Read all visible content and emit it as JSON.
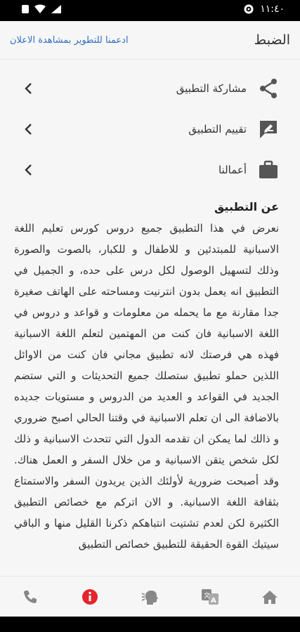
{
  "status_bar": {
    "time": "١١:٤٠"
  },
  "header": {
    "title": "الضبط",
    "support_link": "ادعمنا للتطوير بمشاهدة الاعلان"
  },
  "menu": [
    {
      "label": "مشاركة التطبيق",
      "icon": "share-icon"
    },
    {
      "label": "تقييم التطبيق",
      "icon": "rate-icon"
    },
    {
      "label": "أعمالنا",
      "icon": "briefcase-icon"
    }
  ],
  "about": {
    "title": "عن التطبيق",
    "body": "نعرض في هذا التطبيق جميع دروس كورس تعليم اللغة الاسبانية للمبتدئين و للاطفال و للكبار، بالصوت والصورة وذلك لتسهيل الوصول لكل درس على حده، و الجميل في التطبيق انه يعمل بدون انترنيت ومساحته على الهاتف صغيرة جدا مقارنة مع ما يحمله من معلومات و قواعد و دروس في اللغة الاسبانية فان كنت من المهتمين لتعلم اللغة الاسبانية فهذه هي فرصتك لانه تطبيق مجاني فان كنت من الاوائل اللذين حملو تطبيق ستصلك جميع التحديثات و التي ستضم الجديد في القواعد و العديد من الدروس و مستويات جديده بالاضافة الى ان تعلم الاسبانية في وقتنا الحالي اصبح ضروري و ذالك لما يمكن ان تقدمه الدول التي تتحدث الاسبانية و ذلك لكل شخص يتقن الاسبانية و من خلال السفر و العمل هناك. وقد أصبحت ضرورية لأولئك الذين يريدون السفر والاستمتاع بثقافة اللغة الاسبانية. و الان اتركم مع خصائص التطبيق الكثيرة لكن لعدم تشتيت انتباهكم ذكرنا القليل منها و الباقي سيتيك القوة الحقيقة للتطبيق خصائص التطبيق"
  },
  "bottom_nav": [
    {
      "icon": "phone-icon"
    },
    {
      "icon": "info-icon",
      "active": true,
      "color": "#e4262c"
    },
    {
      "icon": "speaking-head-icon"
    },
    {
      "icon": "translate-icon"
    },
    {
      "icon": "home-icon"
    }
  ],
  "colors": {
    "link": "#2f6fbd",
    "active": "#e4262c",
    "icon": "#555555"
  }
}
